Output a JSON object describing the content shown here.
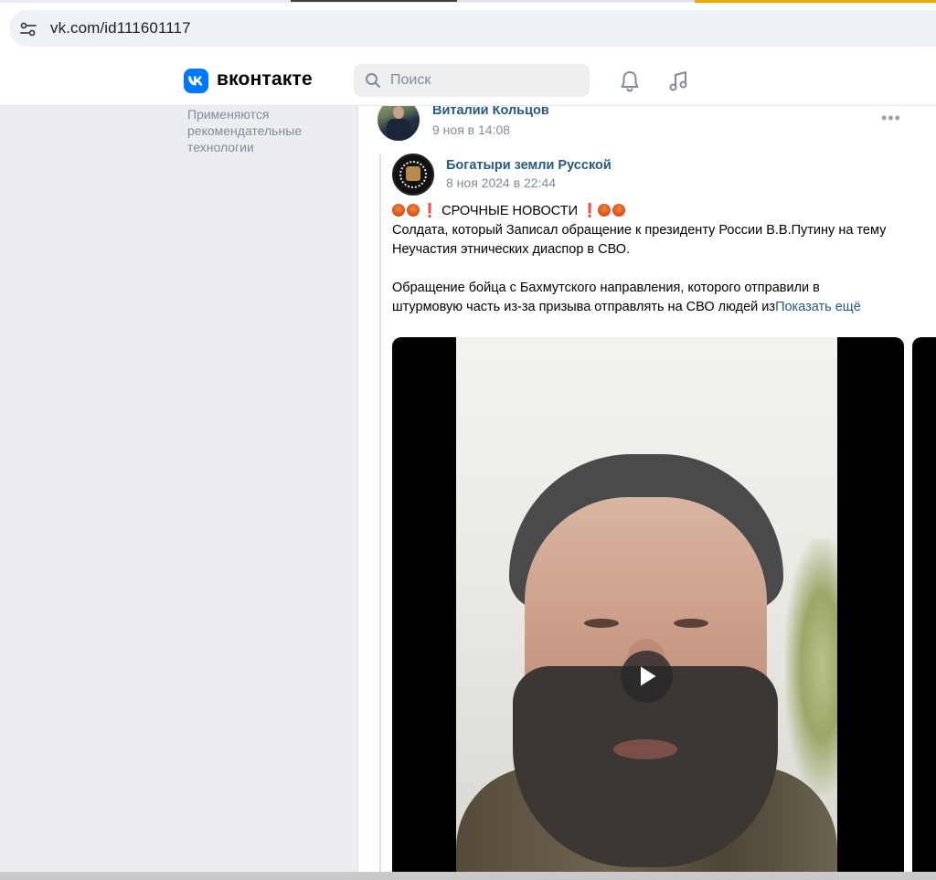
{
  "browser": {
    "url": "vk.com/id111601117"
  },
  "header": {
    "logo_text": "вконтакте",
    "search_placeholder": "Поиск",
    "brand_color": "#0077ff"
  },
  "sidebar": {
    "recommendation_note": "Применяются рекомендательные технологии"
  },
  "post": {
    "author": "Виталий Кольцов",
    "date": "9 ноя в 14:08",
    "repost": {
      "author": "Богатыри земли Русской",
      "date": "8 ноя 2024 в 22:44",
      "headline": "СРОЧНЫЕ НОВОСТИ",
      "line1": "Солдата, который Записал обращение к президенту России В.В.Путину на тему",
      "line2": "Неучастия этнических диаспор в СВО.",
      "line3": "Обращение бойца с Бахмутского направления, которого отправили в",
      "line4": "штурмовую часть из-за призыва отправлять на СВО людей из",
      "show_more": "Показать ещё"
    }
  }
}
